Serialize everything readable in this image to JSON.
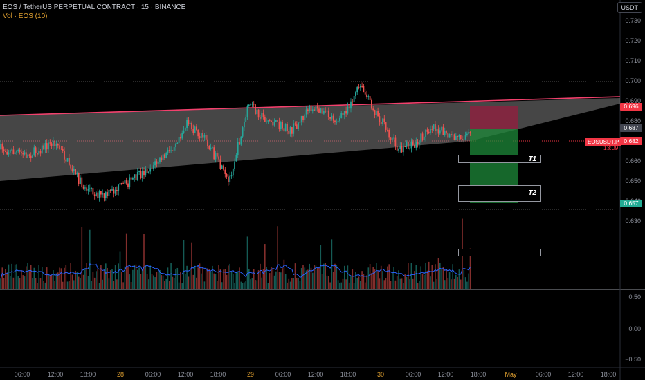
{
  "header": {
    "title": "EOS / TetherUS PERPETUAL CONTRACT · 15 · BINANCE",
    "volume_label": "Vol · EOS (10)",
    "currency_button": "USDT"
  },
  "price_axis": {
    "labels": [
      "0.730",
      "0.720",
      "0.710",
      "0.700",
      "0.690",
      "0.680",
      "0.670",
      "0.660",
      "0.650",
      "0.640",
      "0.630"
    ],
    "tags": [
      {
        "text": "0.696",
        "bg": "#f23645",
        "fg": "#ffffff"
      },
      {
        "text": "0.687",
        "bg": "#434651",
        "fg": "#ffffff"
      },
      {
        "text": "0.682",
        "bg": "#f23645",
        "fg": "#ffffff"
      },
      {
        "text": "0.657",
        "bg": "#22ab94",
        "fg": "#ffffff"
      }
    ],
    "symbol_tag": "EOSUSDT.P",
    "countdown": "13:09"
  },
  "osc_axis": {
    "labels": [
      "0.50",
      "0.00",
      "−0.50"
    ]
  },
  "time_axis": [
    {
      "text": "06:00",
      "day": false
    },
    {
      "text": "12:00",
      "day": false
    },
    {
      "text": "18:00",
      "day": false
    },
    {
      "text": "28",
      "day": true
    },
    {
      "text": "06:00",
      "day": false
    },
    {
      "text": "12:00",
      "day": false
    },
    {
      "text": "18:00",
      "day": false
    },
    {
      "text": "29",
      "day": true
    },
    {
      "text": "06:00",
      "day": false
    },
    {
      "text": "12:00",
      "day": false
    },
    {
      "text": "18:00",
      "day": false
    },
    {
      "text": "30",
      "day": true
    },
    {
      "text": "06:00",
      "day": false
    },
    {
      "text": "12:00",
      "day": false
    },
    {
      "text": "18:00",
      "day": false
    },
    {
      "text": "May",
      "day": true
    },
    {
      "text": "06:00",
      "day": false
    },
    {
      "text": "12:00",
      "day": false
    },
    {
      "text": "18:00",
      "day": false
    }
  ],
  "targets": {
    "t1": "T1",
    "t2": "T2"
  },
  "colors": {
    "up": "#26a69a",
    "down": "#ef5350",
    "volume_ma": "#2962ff",
    "triangle_fill": "#808080",
    "triangle_edge": "#f2416d",
    "stop_zone": "#8c2240",
    "profit_zone": "#1e8a3a"
  },
  "chart_data": {
    "type": "candlestick",
    "symbol": "EOSUSDT.P",
    "exchange": "BINANCE",
    "interval": "15",
    "current_price": 0.682,
    "y_range": [
      0.625,
      0.735
    ],
    "trade_setup": {
      "direction": "short",
      "stop": 0.696,
      "entry": 0.687,
      "target_1": 0.674,
      "target_2": 0.66,
      "take_profit": 0.657
    },
    "wedge": {
      "upper": [
        [
          0,
          0.691
        ],
        [
          896,
          0.699
        ]
      ],
      "lower": [
        [
          0,
          0.665
        ],
        [
          680,
          0.688
        ]
      ]
    },
    "volume_ma_length": 10
  }
}
